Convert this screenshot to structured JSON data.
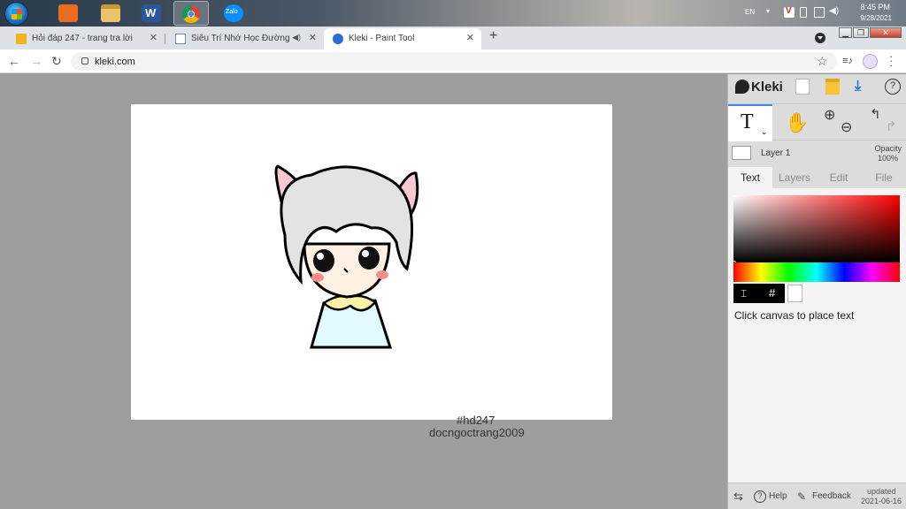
{
  "taskbar": {
    "apps": [
      {
        "name": "windows-media-player",
        "color": "#e86d1f"
      },
      {
        "name": "file-explorer",
        "color": "#e9c46a"
      },
      {
        "name": "word",
        "color": "#2b579a"
      },
      {
        "name": "chrome",
        "color": "#4caf50"
      },
      {
        "name": "zalo",
        "color": "#0a8fff",
        "label": "Zalo"
      }
    ],
    "language": "EN",
    "clock_time": "8:45 PM",
    "clock_date": "9/28/2021"
  },
  "browser": {
    "tabs": [
      {
        "title": "Hỏi đáp 247 - trang tra lời",
        "favicon_color": "#f2b21b"
      },
      {
        "title": "Siêu Trí Nhớ Học Đường",
        "favicon_color": "#6c8ebf"
      },
      {
        "title": "Kleki - Paint Tool",
        "favicon_color": "#2a6dd6"
      }
    ],
    "url": "kleki.com"
  },
  "canvas": {
    "signature_line1": "#hd247",
    "signature_line2": "docngoctrang2009"
  },
  "kleki": {
    "logo": "Kleki",
    "layer_name": "Layer 1",
    "opacity_label": "Opacity",
    "opacity_value": "100%",
    "panel_tabs": [
      "Text",
      "Layers",
      "Edit",
      "File"
    ],
    "hint": "Click canvas to place text",
    "picker_hash": "#",
    "footer": {
      "help": "Help",
      "feedback": "Feedback",
      "updated_label": "updated",
      "updated_date": "2021-06-16"
    },
    "accent_color": "#3a8ee6"
  }
}
